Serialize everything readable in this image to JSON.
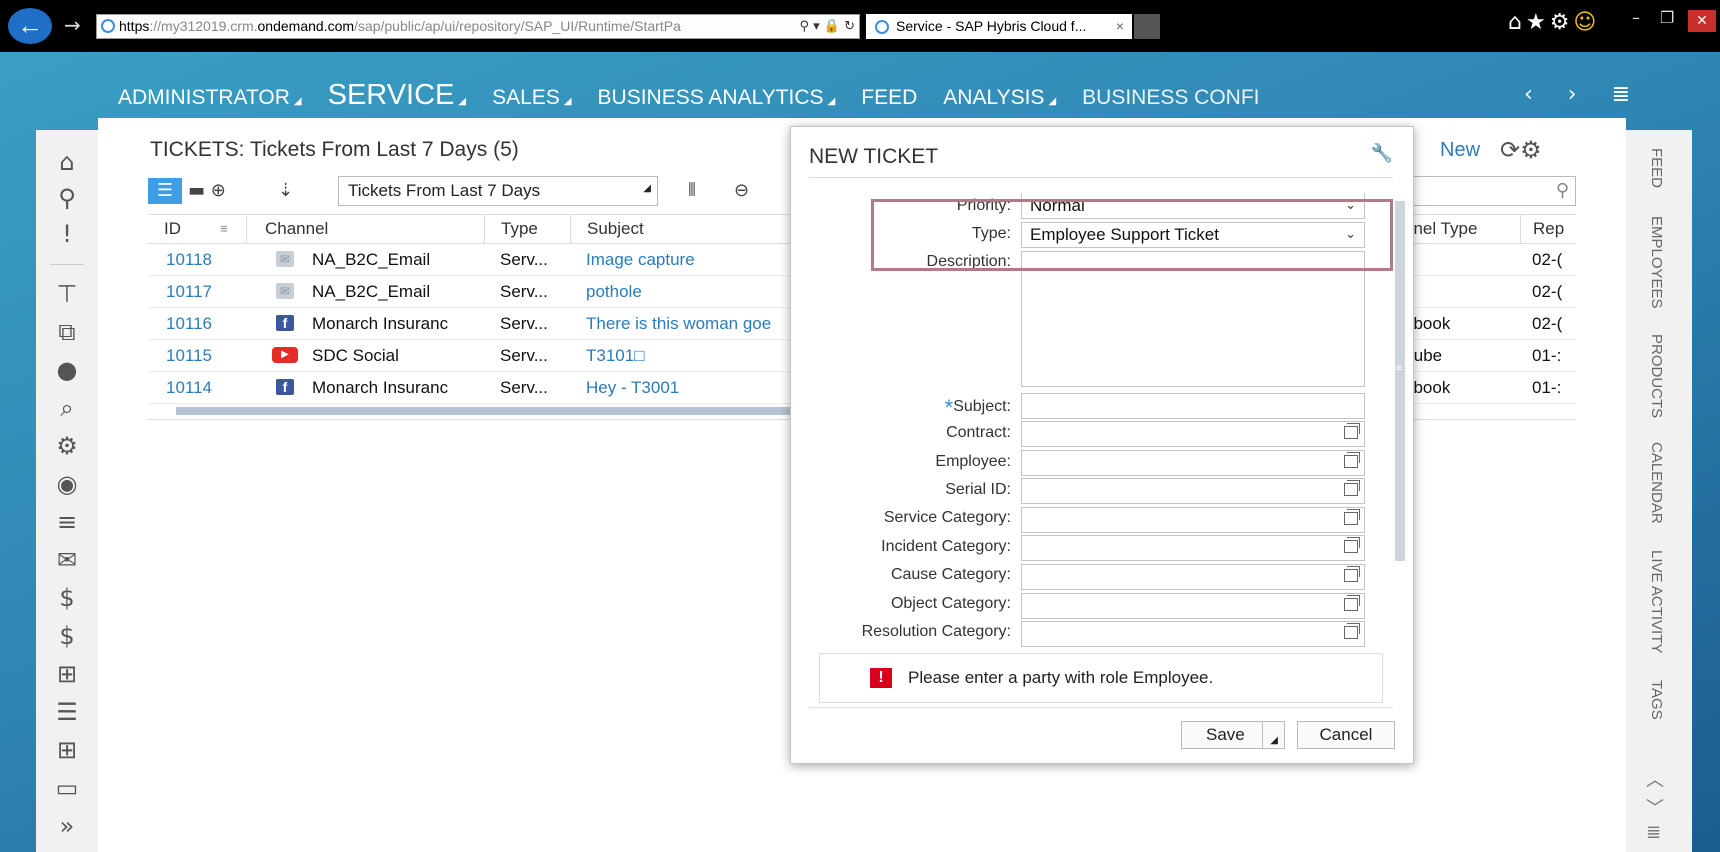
{
  "browser": {
    "url_scheme": "https",
    "url_pre": "://my312019.crm.",
    "url_domain": "ondemand.com",
    "url_post": "/sap/public/ap/ui/repository/SAP_UI/Runtime/StartPa",
    "addr_icons": "⚲ ▾ 🔒 ↻",
    "tab_title": "Service - SAP Hybris Cloud f...",
    "tab_close": "×",
    "chrome_icons": "⌂★⚙",
    "smile": "☺",
    "minimize": "–",
    "restore": "❐",
    "close": "✕"
  },
  "nav": {
    "items": [
      {
        "label": "ADMINISTRATOR"
      },
      {
        "label": "SERVICE"
      },
      {
        "label": "SALES"
      },
      {
        "label": "BUSINESS ANALYTICS"
      },
      {
        "label": "FEED"
      },
      {
        "label": "ANALYSIS"
      },
      {
        "label": "BUSINESS CONFI"
      }
    ],
    "arrows": "‹ › ≣"
  },
  "sidebar": {
    "icons": [
      "home-icon",
      "search-icon",
      "alert-icon",
      "org-chart-icon",
      "cube-icon",
      "circle-icon",
      "inspect-icon",
      "gear-icon",
      "person-icon",
      "people-list-icon",
      "mail-icon",
      "money-transfer-icon",
      "dollar-icon",
      "person-board-icon",
      "report-icon",
      "calendar-grid-icon",
      "chat-money-icon",
      "expand-icon"
    ],
    "glyphs": [
      "⌂",
      "⚲",
      "!",
      "⊤",
      "⧉",
      "●",
      "⌕",
      "⚙",
      "◉",
      "≡",
      "✉",
      "$",
      "$",
      "⊞",
      "☰",
      "⊞",
      "▭",
      "»"
    ]
  },
  "rightrail": {
    "labels": [
      "FEED",
      "EMPLOYEES",
      "PRODUCTS",
      "CALENDAR",
      "LIVE ACTIVITY",
      "TAGS"
    ],
    "arrows": [
      "︿",
      "﹀",
      "≣"
    ]
  },
  "page": {
    "title": "TICKETS: Tickets From Last 7 Days (5)",
    "query": "Tickets From Last 7 Days",
    "new_label": "New",
    "header_icons": "⟳⚙",
    "list_view": "☰",
    "other_views": "▬ ⊕",
    "sort": "⇣",
    "columns_icon": "⦀",
    "zoom_icon": "⊖",
    "search_icon": "⚲"
  },
  "grid": {
    "headers": [
      "ID",
      "Channel",
      "Type",
      "Subject",
      "nnel Type",
      "Rep"
    ],
    "rows": [
      {
        "id": "10118",
        "channel": "NA_B2C_Email",
        "channel_icon": "✉",
        "type": "Serv...",
        "subject": "Image capture",
        "channel_type": "",
        "rep": "02-("
      },
      {
        "id": "10117",
        "channel": "NA_B2C_Email",
        "channel_icon": "✉",
        "type": "Serv...",
        "subject": "pothole",
        "channel_type": "",
        "rep": "02-("
      },
      {
        "id": "10116",
        "channel": "Monarch Insuranc",
        "channel_icon": "f",
        "type": "Serv...",
        "subject": "There is this woman goe",
        "channel_type": "ebook",
        "rep": "02-("
      },
      {
        "id": "10115",
        "channel": "SDC Social",
        "channel_icon": "▶",
        "type": "Serv...",
        "subject": "T3101□",
        "channel_type": "Tube",
        "rep": "01-:"
      },
      {
        "id": "10114",
        "channel": "Monarch Insuranc",
        "channel_icon": "f",
        "type": "Serv...",
        "subject": "Hey - T3001",
        "channel_type": "ebook",
        "rep": "01-:"
      }
    ]
  },
  "dialog": {
    "title": "NEW TICKET",
    "wrench": "🔧",
    "fields": {
      "priority": {
        "label": "Priority:",
        "value": "Normal"
      },
      "type": {
        "label": "Type:",
        "value": "Employee Support Ticket"
      },
      "description": {
        "label": "Description:",
        "value": ""
      },
      "subject": {
        "label": "Subject:",
        "required": "*",
        "value": ""
      },
      "contract": {
        "label": "Contract:",
        "value": ""
      },
      "employee": {
        "label": "Employee:",
        "value": ""
      },
      "serial_id": {
        "label": "Serial ID:",
        "value": ""
      },
      "service_category": {
        "label": "Service Category:",
        "value": ""
      },
      "incident_category": {
        "label": "Incident Category:",
        "value": ""
      },
      "cause_category": {
        "label": "Cause Category:",
        "value": ""
      },
      "object_category": {
        "label": "Object Category:",
        "value": ""
      },
      "resolution_category": {
        "label": "Resolution Category:",
        "value": ""
      }
    },
    "dropdown_glyph": "⌄",
    "error_icon": "!",
    "error": "Please enter a party with role Employee.",
    "save": "Save",
    "cancel": "Cancel"
  },
  "colors": {
    "accent": "#2b7bbf",
    "error": "#d9001b",
    "highlight": "#b07a86"
  }
}
